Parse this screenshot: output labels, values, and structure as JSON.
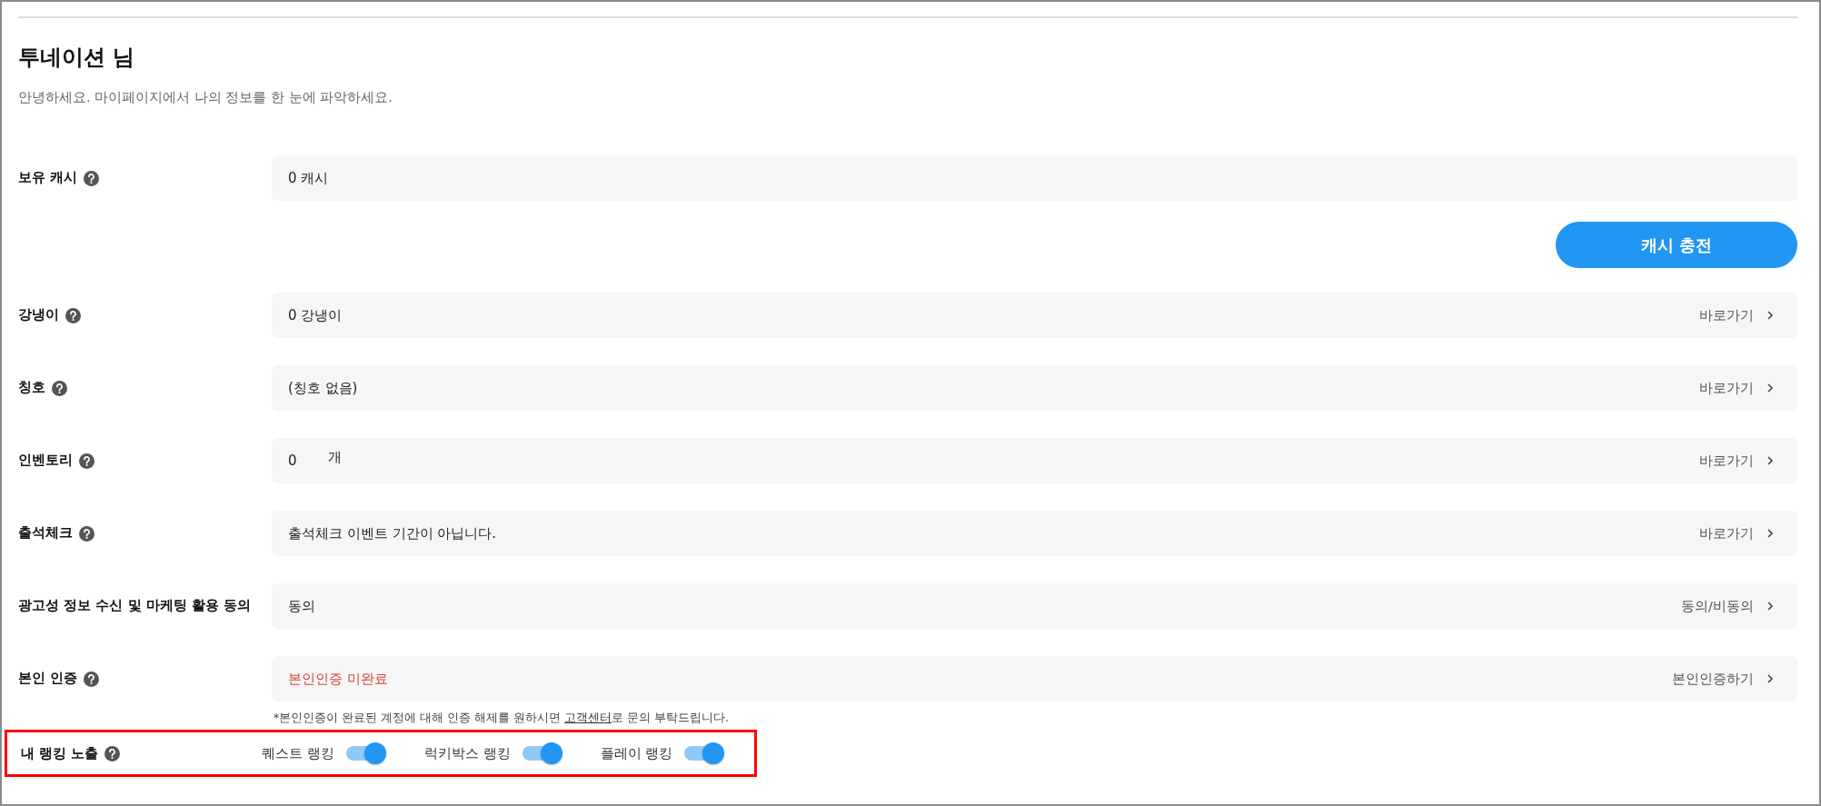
{
  "greeting": {
    "title": "투네이션 님",
    "subtitle": "안녕하세요. 마이페이지에서 나의 정보를 한 눈에 파악하세요."
  },
  "rows": [
    {
      "label": "보유 캐시",
      "help": true,
      "value": "0 캐시",
      "alert": false
    },
    {
      "kind": "button",
      "label": "캐시 충전"
    },
    {
      "label": "강냉이",
      "help": true,
      "value": "0 강냉이",
      "alert": false,
      "action": "바로가기"
    },
    {
      "label": "칭호",
      "help": true,
      "value": "(칭호 없음)",
      "alert": false,
      "action": "바로가기"
    },
    {
      "label": "인벤토리",
      "help": true,
      "value": "0",
      "unit": "개",
      "alert": false,
      "action": "바로가기"
    },
    {
      "label": "출석체크",
      "help": true,
      "value": "출석체크 이벤트 기간이 아닙니다.",
      "alert": false,
      "action": "바로가기"
    },
    {
      "label": "광고성 정보 수신 및 마케팅 활용 동의",
      "help": false,
      "value": "동의",
      "alert": false,
      "action": "동의/비동의"
    },
    {
      "label": "본인 인증",
      "help": true,
      "value": "본인인증 미완료",
      "alert": true,
      "action": "본인인증하기"
    }
  ],
  "note": {
    "before": "*본인인증이 완료된 계정에 대해 인증 해제를 원하시면 ",
    "link": "고객센터",
    "after": "로 문의 부탁드립니다."
  },
  "ranking": {
    "label": "내 랭킹 노출",
    "help": true,
    "highlighted": true,
    "toggles": [
      {
        "label": "퀘스트 랭킹",
        "on": true
      },
      {
        "label": "럭키박스 랭킹",
        "on": true
      },
      {
        "label": "플레이 랭킹",
        "on": true
      }
    ]
  }
}
